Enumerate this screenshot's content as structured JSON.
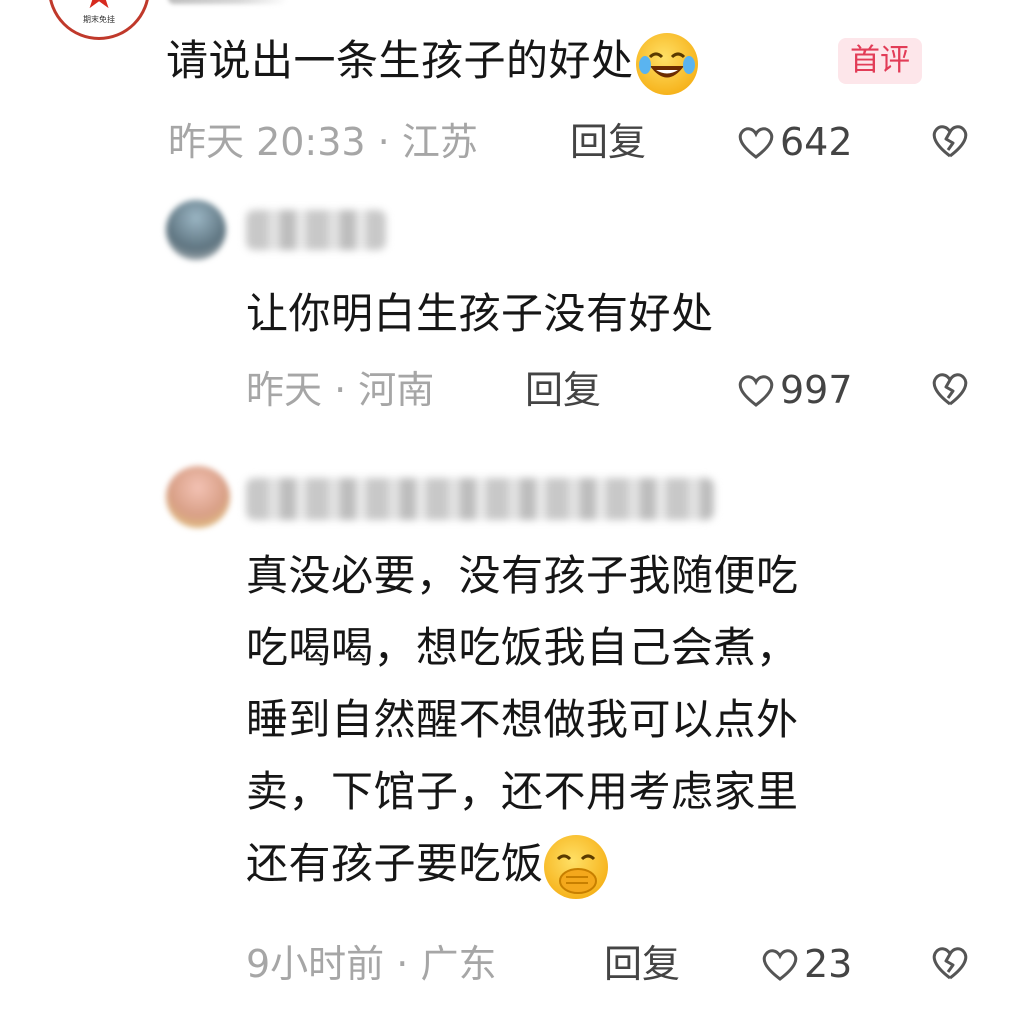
{
  "comments": [
    {
      "text": "请说出一条生孩子的好处",
      "badge": "首评",
      "time": "昨天 20:33",
      "location": "江苏",
      "reply_label": "回复",
      "likes": "642",
      "emoji": "laughing-crying-emoji"
    },
    {
      "text": "让你明白生孩子没有好处",
      "time": "昨天",
      "location": "河南",
      "reply_label": "回复",
      "likes": "997"
    },
    {
      "lines": [
        "真没必要，没有孩子我随便吃",
        "吃喝喝，想吃饭我自己会煮，",
        "睡到自然醒不想做我可以点外",
        "卖，下馆子，还不用考虑家里",
        "还有孩子要吃饭"
      ],
      "time": "9小时前",
      "location": "广东",
      "reply_label": "回复",
      "likes": "23",
      "emoji": "hand-over-mouth-emoji"
    }
  ],
  "colors": {
    "badge_bg": "#fde6ea",
    "badge_text": "#e23c57",
    "meta_text": "#a6a6a6",
    "body_text": "#161616"
  }
}
